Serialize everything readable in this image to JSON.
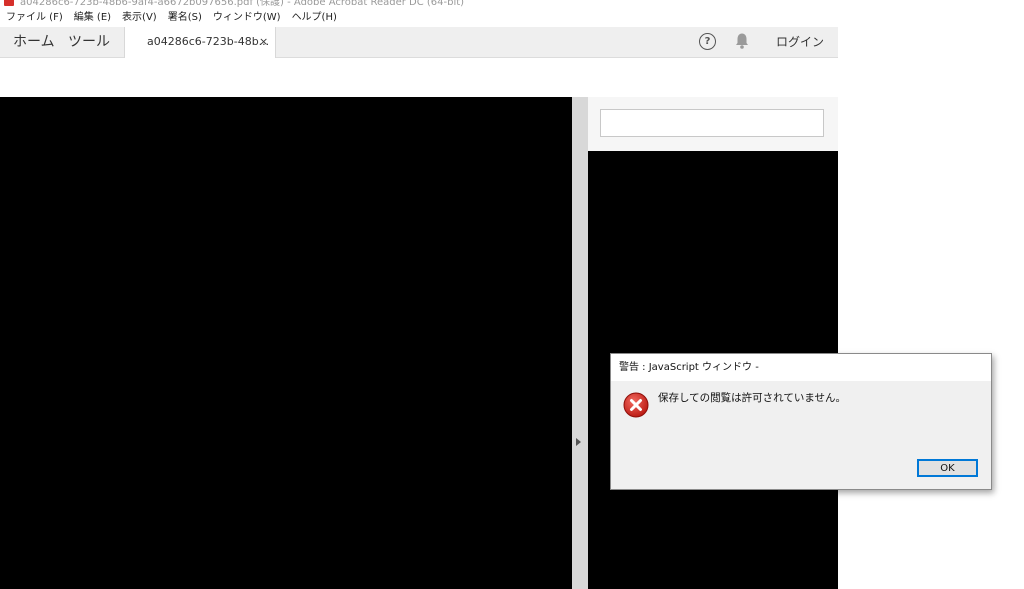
{
  "window": {
    "title": "a04286c6-723b-48b6-9af4-a6672b097656.pdf (保護) - Adobe Acrobat Reader DC (64-bit)"
  },
  "menu": {
    "items": [
      "ファイル (F)",
      "編集 (E)",
      "表示(V)",
      "署名(S)",
      "ウィンドウ(W)",
      "ヘルプ(H)"
    ]
  },
  "tabs": {
    "home": "ホーム",
    "tools": "ツール",
    "document": "a04286c6-723b-48b...",
    "close": "×"
  },
  "header": {
    "help_icon": "?",
    "login": "ログイン"
  },
  "search": {
    "value": "",
    "placeholder": ""
  },
  "dialog": {
    "title": "警告 : JavaScript ウィンドウ -",
    "message": "保存しての閲覧は許可されていません。",
    "ok": "OK"
  },
  "icons": {
    "app": "acrobat-icon",
    "help": "help-icon",
    "notifications": "bell-icon",
    "error": "error-icon",
    "collapse": "collapse-arrow-icon"
  },
  "colors": {
    "acrobat_red": "#d6302b",
    "error_red": "#c8211e",
    "focus_blue": "#0078d7"
  }
}
